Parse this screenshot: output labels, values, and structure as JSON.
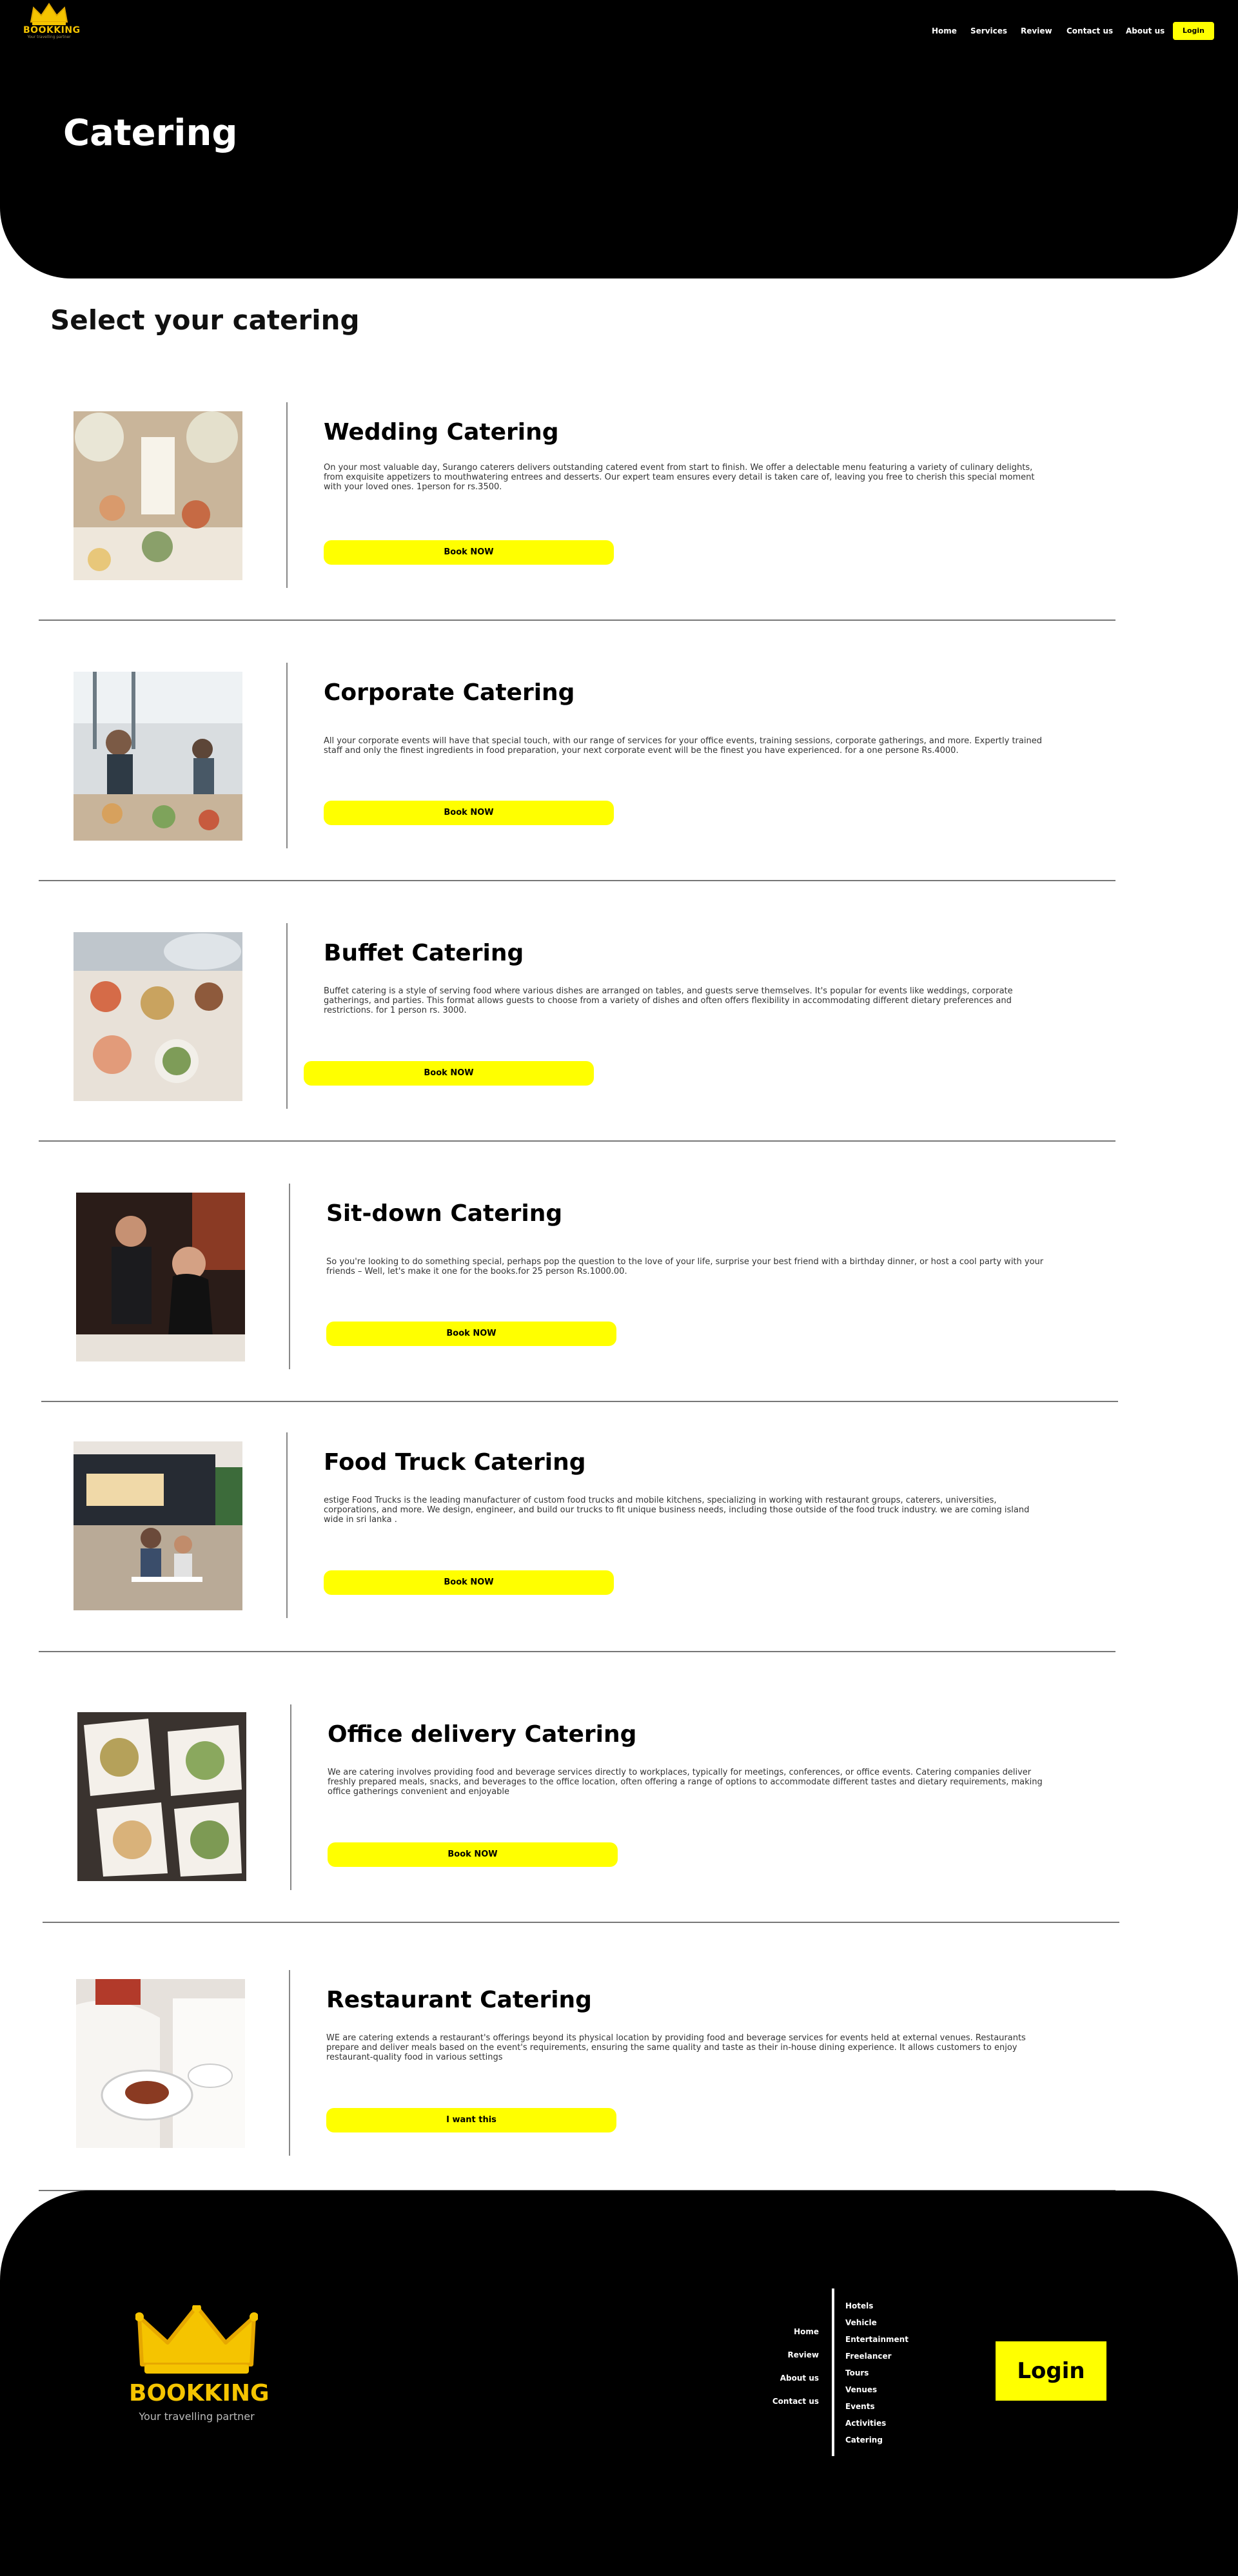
{
  "brand": {
    "name": "BOOKKING",
    "tagline": "Your travelling partner"
  },
  "nav": {
    "items": [
      "Home",
      "Services",
      "Review",
      "Contact us",
      "About us"
    ],
    "login": "Login"
  },
  "hero": {
    "title": "Catering"
  },
  "section_title": "Select your catering",
  "cards": [
    {
      "title": "Wedding Catering",
      "desc": "On your most valuable day, Surango caterers delivers outstanding catered event from start to finish. We offer a delectable menu featuring a variety of culinary delights, from exquisite appetizers to mouthwatering entrees and desserts. Our expert team ensures every detail is taken care of, leaving you free to cherish this special moment with your loved ones. 1person for rs.3500.",
      "button": "Book NOW",
      "image": "wedding-catering-photo"
    },
    {
      "title": "Corporate Catering",
      "desc": "All your corporate events will have that special touch, with our range of services for your office events, training sessions, corporate gatherings, and more. Expertly trained staff and only the finest ingredients in food preparation, your next corporate event will be the finest you have experienced. for a one persone Rs.4000.",
      "button": "Book NOW",
      "image": "corporate-catering-photo"
    },
    {
      "title": "Buffet Catering",
      "desc": "Buffet catering is a style of serving food where various dishes are arranged on tables, and guests serve themselves. It's popular for events like weddings, corporate gatherings, and parties. This format allows guests to choose from a variety of dishes and often offers flexibility in accommodating different dietary preferences and restrictions. for 1 person rs. 3000.",
      "button": "Book NOW",
      "image": "buffet-catering-photo"
    },
    {
      "title": "Sit-down Catering",
      "desc": "So you're looking to do something special, perhaps pop the question to the love of your life, surprise your best friend with a birthday dinner, or host a cool party with your friends – Well, let's make it one for the books.for 25 person Rs.1000.00.",
      "button": "Book NOW",
      "image": "sit-down-catering-photo"
    },
    {
      "title": "Food Truck Catering",
      "desc": "estige Food Trucks is the leading manufacturer of custom food trucks and mobile kitchens, specializing in working with restaurant groups, caterers, universities, corporations, and more. We design, engineer, and build our trucks to fit unique business needs, including those outside of the food truck industry.  we are coming island wide in sri lanka .",
      "button": "Book NOW",
      "image": "food-truck-catering-photo"
    },
    {
      "title": "Office delivery Catering",
      "desc": "We are catering involves providing food and beverage services directly to workplaces, typically for meetings, conferences, or office events. Catering companies deliver freshly prepared meals, snacks, and beverages to the office location, often offering a range of options to accommodate different tastes and dietary requirements, making office gatherings convenient and enjoyable",
      "button": "Book NOW",
      "image": "office-delivery-catering-photo"
    },
    {
      "title": "Restaurant Catering",
      "desc": "WE are catering extends a restaurant's offerings beyond its physical location by providing food and beverage services for events held at external venues. Restaurants prepare and deliver meals based on the event's requirements, ensuring the same quality and taste as their in-house dining experience. It allows customers to enjoy restaurant-quality food in various settings",
      "button": "I want this",
      "image": "restaurant-catering-photo"
    }
  ],
  "footer": {
    "links_left": [
      "Home",
      "Review",
      "About us",
      "Contact us"
    ],
    "links_right": [
      "Hotels",
      "Vehicle",
      "Entertainment",
      "Freelancer",
      "Tours",
      "Venues",
      "Events",
      "Activities",
      "Catering"
    ],
    "login": "Login"
  },
  "colors": {
    "accent": "#ffff00",
    "brand": "#f5c400",
    "background": "#000000"
  }
}
